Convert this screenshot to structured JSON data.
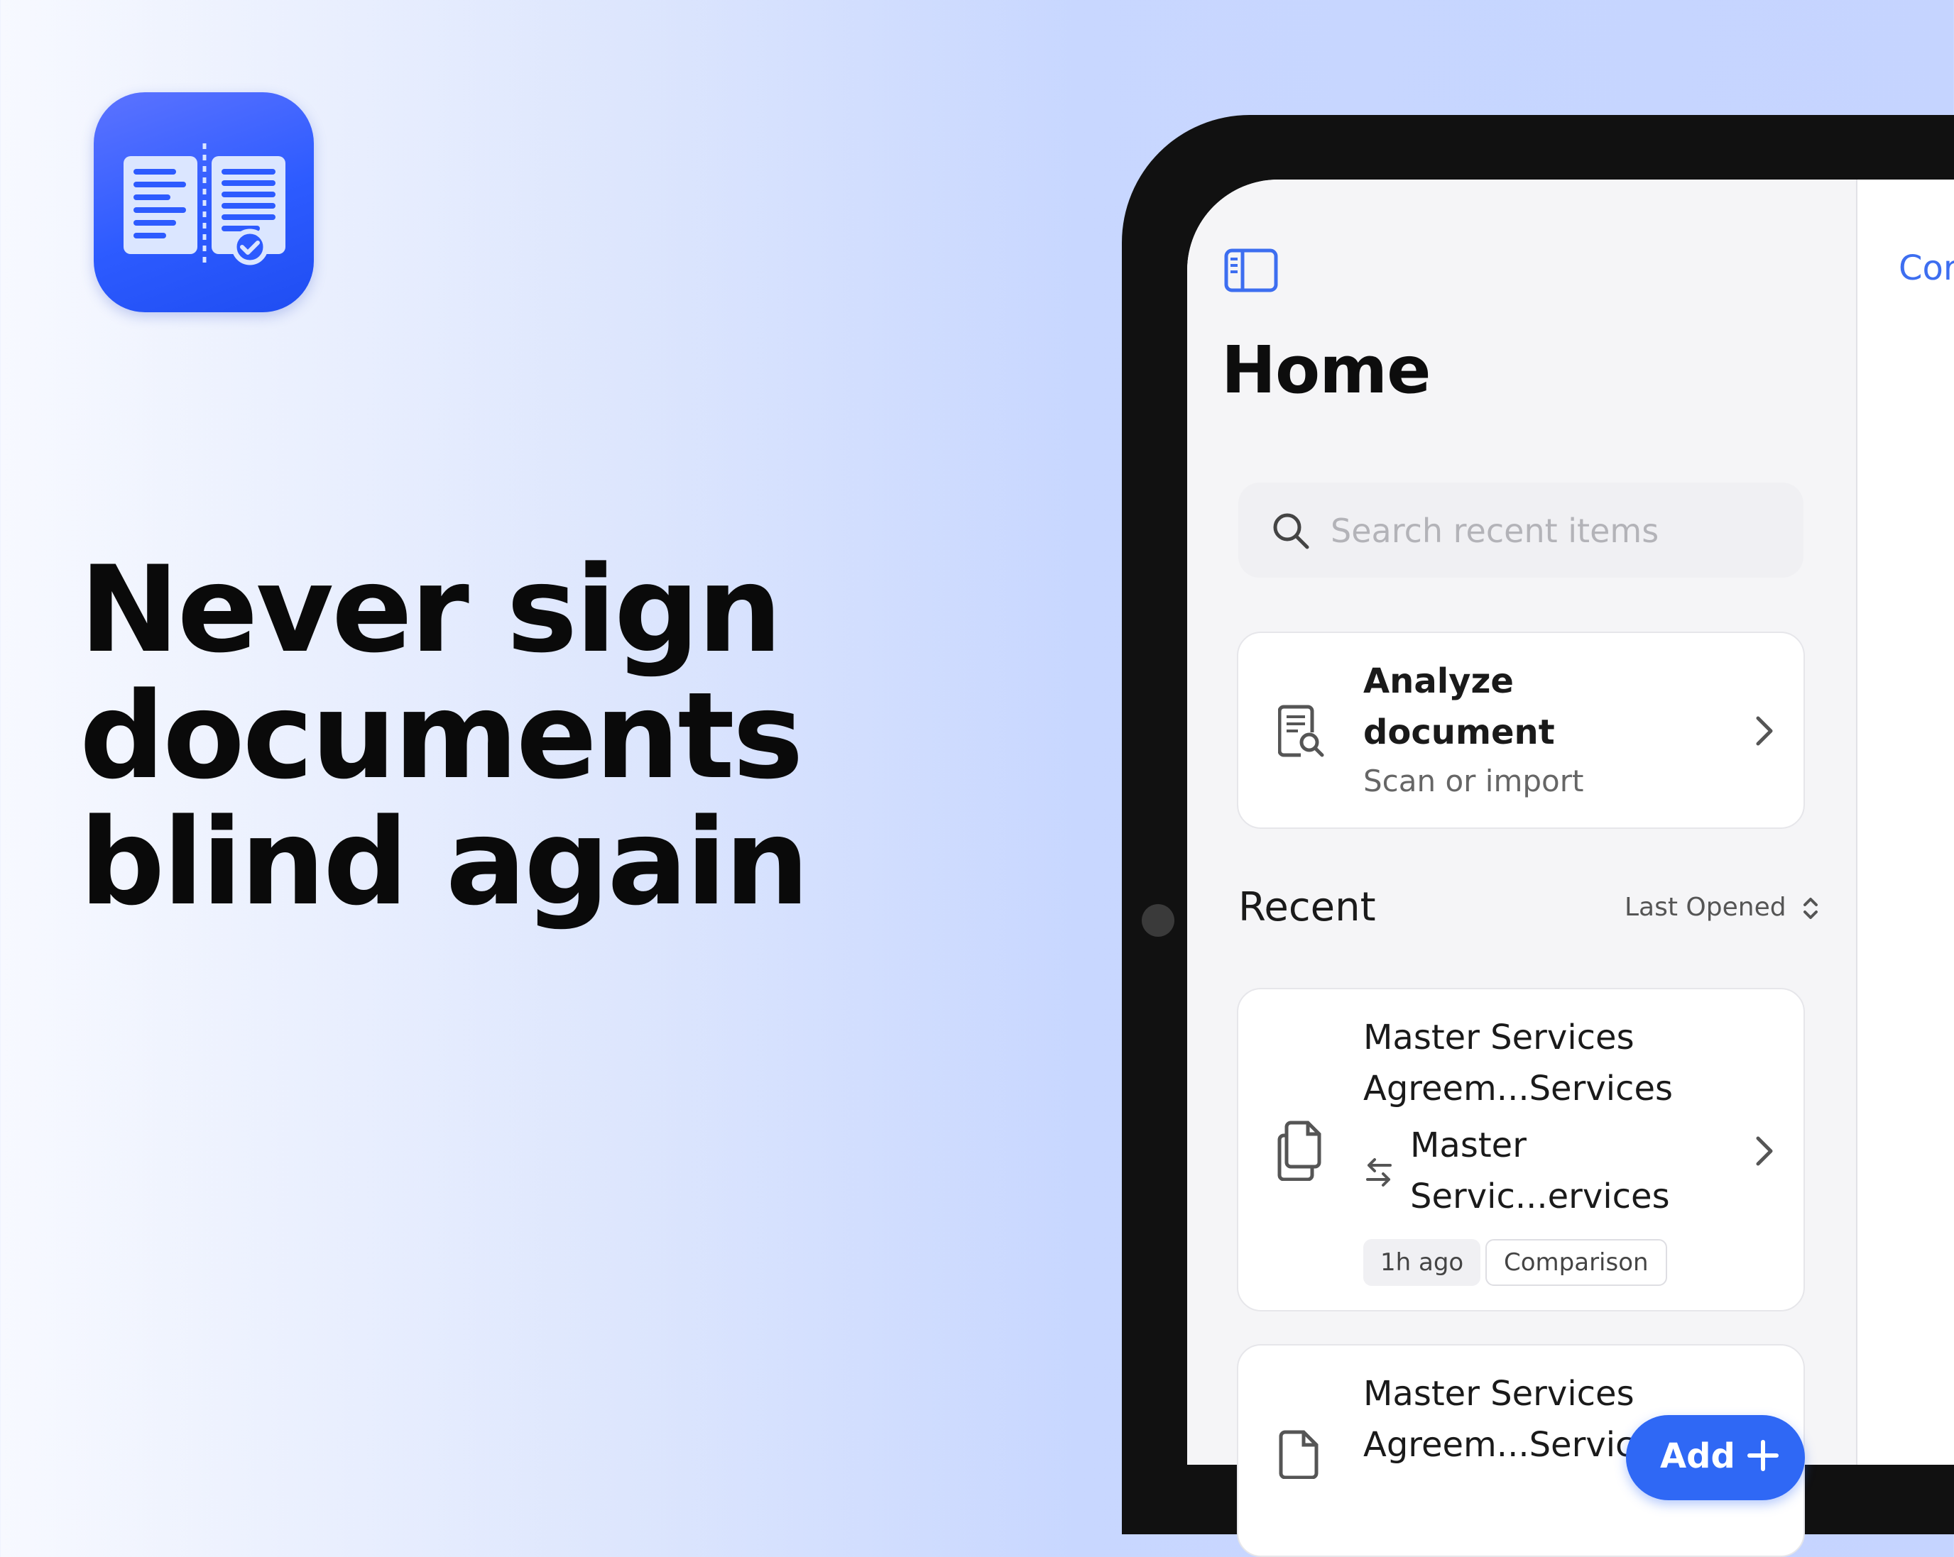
{
  "marketing": {
    "headline_lines": [
      "Never sign",
      "documents",
      "blind again"
    ]
  },
  "app": {
    "icon_name": "document-compare-icon",
    "accent_color": "#2f68f5"
  },
  "sidebar": {
    "title": "Home",
    "toggle_icon": "sidebar-icon",
    "search": {
      "placeholder": "Search recent items",
      "value": ""
    },
    "analyze_card": {
      "title_line1": "Analyze",
      "title_line2": "document",
      "subtitle": "Scan or import",
      "icon": "document-search-icon"
    },
    "recent": {
      "label": "Recent",
      "sort_label": "Last Opened",
      "items": [
        {
          "title_line1": "Master Services",
          "title_line2": "Agreem...Services",
          "compare_line1": "Master",
          "compare_line2": "Servic...ervices",
          "time": "1h ago",
          "kind": "Comparison",
          "icon": "documents-icon"
        },
        {
          "title_line1": "Master Services",
          "title_line2": "Agreem...Servic",
          "icon": "document-icon"
        }
      ]
    },
    "add_button": "Add"
  },
  "detail": {
    "top_button": "Cor"
  }
}
